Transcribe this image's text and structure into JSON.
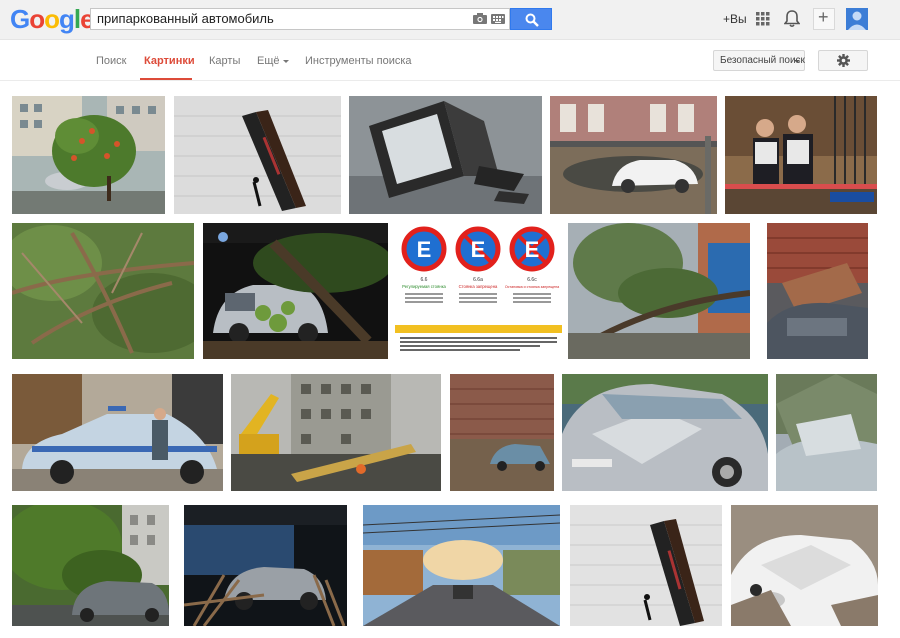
{
  "logo": {
    "letters": [
      "G",
      "o",
      "o",
      "g",
      "l",
      "e"
    ],
    "colors": [
      "#4285f4",
      "#ea4335",
      "#fbbc05",
      "#4285f4",
      "#34a853",
      "#ea4335"
    ]
  },
  "search": {
    "query": "припаркованный автомобиль"
  },
  "header": {
    "plus_you": "+Вы"
  },
  "nav": {
    "items": [
      "Поиск",
      "Картинки",
      "Карты",
      "Ещё",
      "Инструменты поиска"
    ],
    "active": "Картинки"
  },
  "safe_search": {
    "label": "Безопасный поиск"
  },
  "colors": {
    "accent": "#dd4b39",
    "search_button": "#4a87ee"
  },
  "results": {
    "images": [
      {
        "name": "car-under-fallen-tree"
      },
      {
        "name": "poster-books-leaning"
      },
      {
        "name": "broken-tv"
      },
      {
        "name": "white-car-in-puddle"
      },
      {
        "name": "police-officers"
      },
      {
        "name": "fallen-branches"
      },
      {
        "name": "car-under-tree-night"
      },
      {
        "name": "parking-signs",
        "signs": [
          {
            "code": "6.6",
            "title": "Регулируемая стоянка"
          },
          {
            "code": "6.6а",
            "title": "Стоянка запрещена"
          },
          {
            "code": "6.6с",
            "title": "Остановка и стоянка запрещена"
          }
        ]
      },
      {
        "name": "fallen-tree-street"
      },
      {
        "name": "bricks-on-car"
      },
      {
        "name": "police-car"
      },
      {
        "name": "crane-construction"
      },
      {
        "name": "car-near-brick-wall"
      },
      {
        "name": "crushed-silver-car"
      },
      {
        "name": "car-under-debris"
      },
      {
        "name": "car-under-trees"
      },
      {
        "name": "car-crushed-fence"
      },
      {
        "name": "street-view"
      },
      {
        "name": "poster-books-leaning-2"
      },
      {
        "name": "white-car-under-rubble"
      }
    ]
  }
}
